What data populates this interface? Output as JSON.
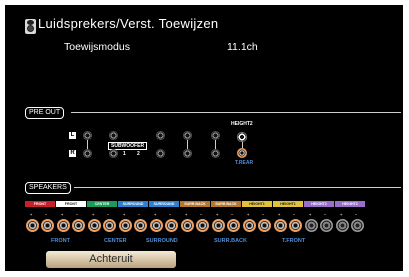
{
  "header": {
    "title": "Luidsprekers/Verst. Toewijzen",
    "mode_label": "Toewijsmodus",
    "mode_value": "11.1ch"
  },
  "preout": {
    "label": "PRE OUT",
    "left_label": "L",
    "right_label": "R",
    "subwoofer_label": "SUBWOOFER",
    "subwoofer_nums": [
      "1",
      "2"
    ],
    "height2_label": "HEIGHT2",
    "trear_label": "T.REAR"
  },
  "speakers": {
    "label": "SPEAKERS",
    "channels": [
      {
        "name": "FRONT",
        "color": "#c8202a",
        "active": true
      },
      {
        "name": "FRONT",
        "color": "#ffffff",
        "active": true
      },
      {
        "name": "CENTER",
        "color": "#1c9a5a",
        "active": true
      },
      {
        "name": "SURROUND",
        "color": "#2d7fd0",
        "active": true
      },
      {
        "name": "SURROUND",
        "color": "#2d7fd0",
        "active": true
      },
      {
        "name": "SURR.BACK",
        "color": "#b5762e",
        "active": true
      },
      {
        "name": "SURR.BACK",
        "color": "#b5762e",
        "active": true
      },
      {
        "name": "HEIGHT1",
        "color": "#e0c33a",
        "active": true
      },
      {
        "name": "HEIGHT1",
        "color": "#e0c33a",
        "active": true
      },
      {
        "name": "HEIGHT2",
        "color": "#9a6fcc",
        "active": false
      },
      {
        "name": "HEIGHT2",
        "color": "#9a6fcc",
        "active": false
      }
    ],
    "bottom_labels": [
      "FRONT",
      "CENTER",
      "SURROUND",
      "SURR.BACK",
      "T.FRONT"
    ]
  },
  "button": {
    "back_label": "Achteruit"
  },
  "colors": {
    "background": "#000000",
    "accent_blue": "#4f8dd6",
    "button_gold": "#d4c3a4"
  }
}
